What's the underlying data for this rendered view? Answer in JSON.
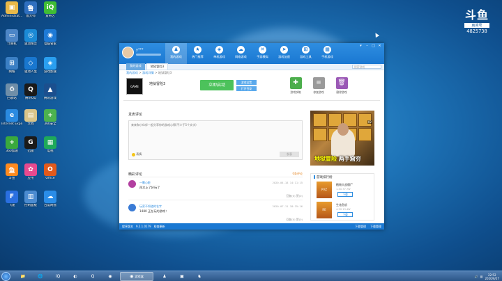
{
  "desktop": {
    "icons": [
      {
        "label": "Administrat...",
        "icon": "folder-user-icon",
        "color": "#e9b949",
        "glyph": "▣"
      },
      {
        "label": "鲁大师",
        "icon": "ludashi-icon",
        "color": "#2f6fbf",
        "glyph": "鲁"
      },
      {
        "label": "爱奇艺",
        "icon": "iqiyi-icon",
        "color": "#3fbd35",
        "glyph": "iQ"
      },
      {
        "label": "计算机",
        "icon": "computer-icon",
        "color": "#4d86c7",
        "glyph": "▭"
      },
      {
        "label": "驱动精灵",
        "icon": "driver-icon",
        "color": "#1b8ad6",
        "glyph": "◎"
      },
      {
        "label": "电脑管家",
        "icon": "pc-manager-icon",
        "color": "#1e7ad6",
        "glyph": "◉"
      },
      {
        "label": "网络",
        "icon": "network-icon",
        "color": "#3b7fc4",
        "glyph": "⊞"
      },
      {
        "label": "驱动人生",
        "icon": "driver-life-icon",
        "color": "#1977cf",
        "glyph": "◇"
      },
      {
        "label": "游戏加速",
        "icon": "game-accel-icon",
        "color": "#2a9ff0",
        "glyph": "◈"
      },
      {
        "label": "回收站",
        "icon": "recycle-bin-icon",
        "color": "#6f8ea8",
        "glyph": "♻"
      },
      {
        "label": "腾讯QQ",
        "icon": "qq-icon",
        "color": "#1a1a1a",
        "glyph": "Q"
      },
      {
        "label": "腾讯游戏",
        "icon": "tencent-game-icon",
        "color": "#1b4f8e",
        "glyph": "▲"
      },
      {
        "label": "Internet Explorer",
        "icon": "ie-icon",
        "color": "#2a8ae0",
        "glyph": "e"
      },
      {
        "label": "文档",
        "icon": "document-icon",
        "color": "#d9c58a",
        "glyph": "▤"
      },
      {
        "label": "360安全",
        "icon": "security-icon",
        "color": "#4cb24f",
        "glyph": "+"
      },
      {
        "label": "360加速",
        "icon": "accel-icon",
        "color": "#3aa93d",
        "glyph": "+"
      },
      {
        "label": "迅雷",
        "icon": "xunlei-icon",
        "color": "#1a1a1a",
        "glyph": "G"
      },
      {
        "label": "电视",
        "icon": "tv-icon",
        "color": "#1ea95a",
        "glyph": "▦"
      },
      {
        "label": "斗鱼",
        "icon": "douyu-icon",
        "color": "#ff8a1f",
        "glyph": "鱼"
      },
      {
        "label": "应用",
        "icon": "apps-icon",
        "color": "#e84a8f",
        "glyph": "✿"
      },
      {
        "label": "Office",
        "icon": "office-icon",
        "color": "#e25a1c",
        "glyph": "O"
      },
      {
        "label": "飞速",
        "icon": "flash-icon",
        "color": "#2a6fe0",
        "glyph": "F"
      },
      {
        "label": "控制面板",
        "icon": "control-panel-icon",
        "color": "#4b8bd0",
        "glyph": "▥"
      },
      {
        "label": "百度网盘",
        "icon": "cloud-icon",
        "color": "#2a8de8",
        "glyph": "☁"
      }
    ]
  },
  "watermark": {
    "logo": "斗鱼",
    "sub": "房间号",
    "room": "4825738"
  },
  "app": {
    "user": {
      "name": "y***"
    },
    "nav": [
      {
        "label": "我的游戏",
        "glyph": "♟",
        "active": true
      },
      {
        "label": "热门推荐",
        "glyph": "★"
      },
      {
        "label": "单机游戏",
        "glyph": "◈"
      },
      {
        "label": "网络游戏",
        "glyph": "☁"
      },
      {
        "label": "手游模拟",
        "glyph": "✕"
      },
      {
        "label": "游戏加速",
        "glyph": "➤"
      },
      {
        "label": "游戏工具",
        "glyph": "⊞"
      },
      {
        "label": "手机游戏",
        "glyph": "▦"
      }
    ],
    "win_controls": [
      "▾",
      "–",
      "□",
      "✕"
    ],
    "subtabs": [
      {
        "label": "我的游戏"
      },
      {
        "label": "地狱冒险3",
        "active": true
      }
    ],
    "search_placeholder": "搜索游戏",
    "breadcrumb": {
      "home": "我的游戏",
      "mid": "游戏详情",
      "current": "地狱冒险3"
    },
    "game": {
      "name": "地狱冒险3",
      "thumb_text": "GAME",
      "launch": "立即启动",
      "btn1": "游戏设置",
      "btn2": "打开目录"
    },
    "tools": [
      {
        "label": "游戏攻略",
        "color": "#4cae4c",
        "glyph": "✚"
      },
      {
        "label": "修复游戏",
        "color": "#9a9a9a",
        "glyph": "≡"
      },
      {
        "label": "删除游戏",
        "color": "#9b59b6",
        "glyph": "🗑"
      }
    ],
    "comment_section": {
      "title": "发表评论",
      "placeholder": "来来和小伙伴一起分享你的游戏心得(不少于5个文字)",
      "emoji_label": "表情",
      "post_label": "发表"
    },
    "hot": {
      "title": "精彩评论",
      "count": "0条评论",
      "comments": [
        {
          "name": "一颗心脏",
          "text": "再次上了好玩了",
          "time": "2020-04-18 14:11:15",
          "actions": "回复(0)  赞(0)",
          "avatar": "#b23fa0"
        },
        {
          "name": "玩家不知道的名字",
          "text": "1480 正在玩的游戏！",
          "time": "2020-07-11 18:35:16",
          "actions": "回复(0)  赞(0)",
          "avatar": "#3a7bd5"
        }
      ]
    },
    "video": {
      "caption_y": "地狱冒险",
      "caption_w": "两手窟穷",
      "badge": "02"
    },
    "ranking": {
      "title": "游戏排行榜",
      "games": [
        {
          "name": "植物大战僵尸",
          "meta": "1.4G    37.7W",
          "btn": "下载",
          "thumb": "PVZ"
        },
        {
          "name": "生化危机",
          "meta": "4.3G    13.4W",
          "btn": "下载",
          "thumb": "RE"
        }
      ]
    },
    "status": {
      "left1": "程序版本",
      "left2": "9.2.1.0179",
      "left3": "检查更新",
      "right1": "下载管理",
      "right2": "下载管理"
    }
  },
  "taskbar": {
    "items": [
      {
        "glyph": "📁",
        "icon": "explorer-icon"
      },
      {
        "glyph": "🌐",
        "icon": "browser-icon"
      },
      {
        "glyph": "iQ",
        "icon": "iqiyi-task-icon"
      },
      {
        "glyph": "◐",
        "icon": "app-task-icon"
      },
      {
        "glyph": "Q",
        "icon": "qq-task-icon"
      },
      {
        "glyph": "◉",
        "icon": "manager-task-icon"
      }
    ],
    "active_label": "游戏盒",
    "more": [
      {
        "glyph": "♟",
        "icon": "game-task-icon"
      },
      {
        "glyph": "▣",
        "icon": "folder-task-icon"
      },
      {
        "glyph": "♞",
        "icon": "douyu-task-icon"
      }
    ],
    "clock_time": "22:52",
    "clock_date": "2020/6/27"
  }
}
